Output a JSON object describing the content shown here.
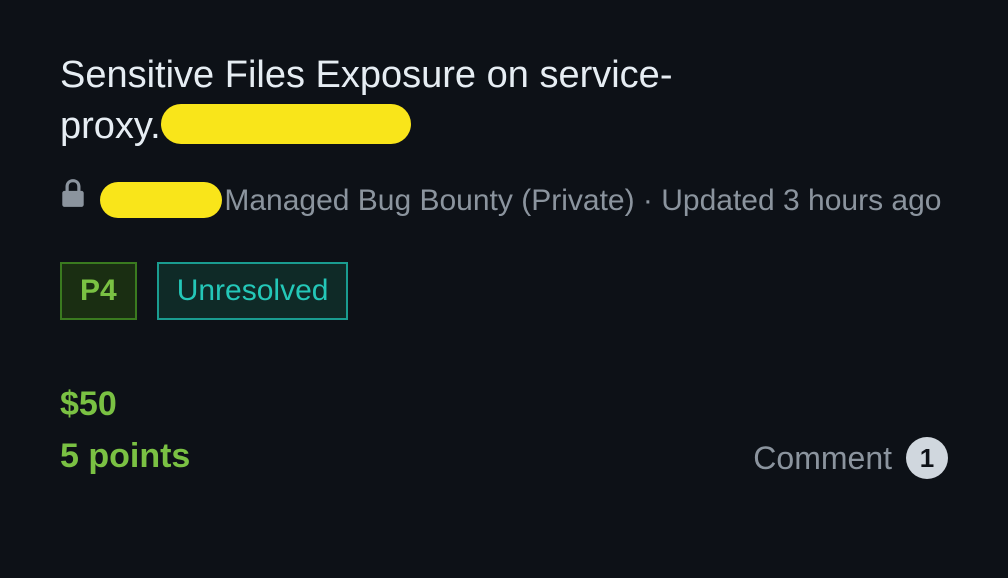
{
  "title": {
    "line1": "Sensitive Files Exposure on service-",
    "line2_prefix": "proxy."
  },
  "meta": {
    "program_suffix": "Managed Bug Bounty (Private)",
    "separator": " · ",
    "updated": "Updated 3 hours ago"
  },
  "badges": {
    "priority": "P4",
    "status": "Unresolved"
  },
  "reward": {
    "amount": "$50",
    "points": "5 points"
  },
  "comments": {
    "label": "Comment",
    "count": "1"
  }
}
